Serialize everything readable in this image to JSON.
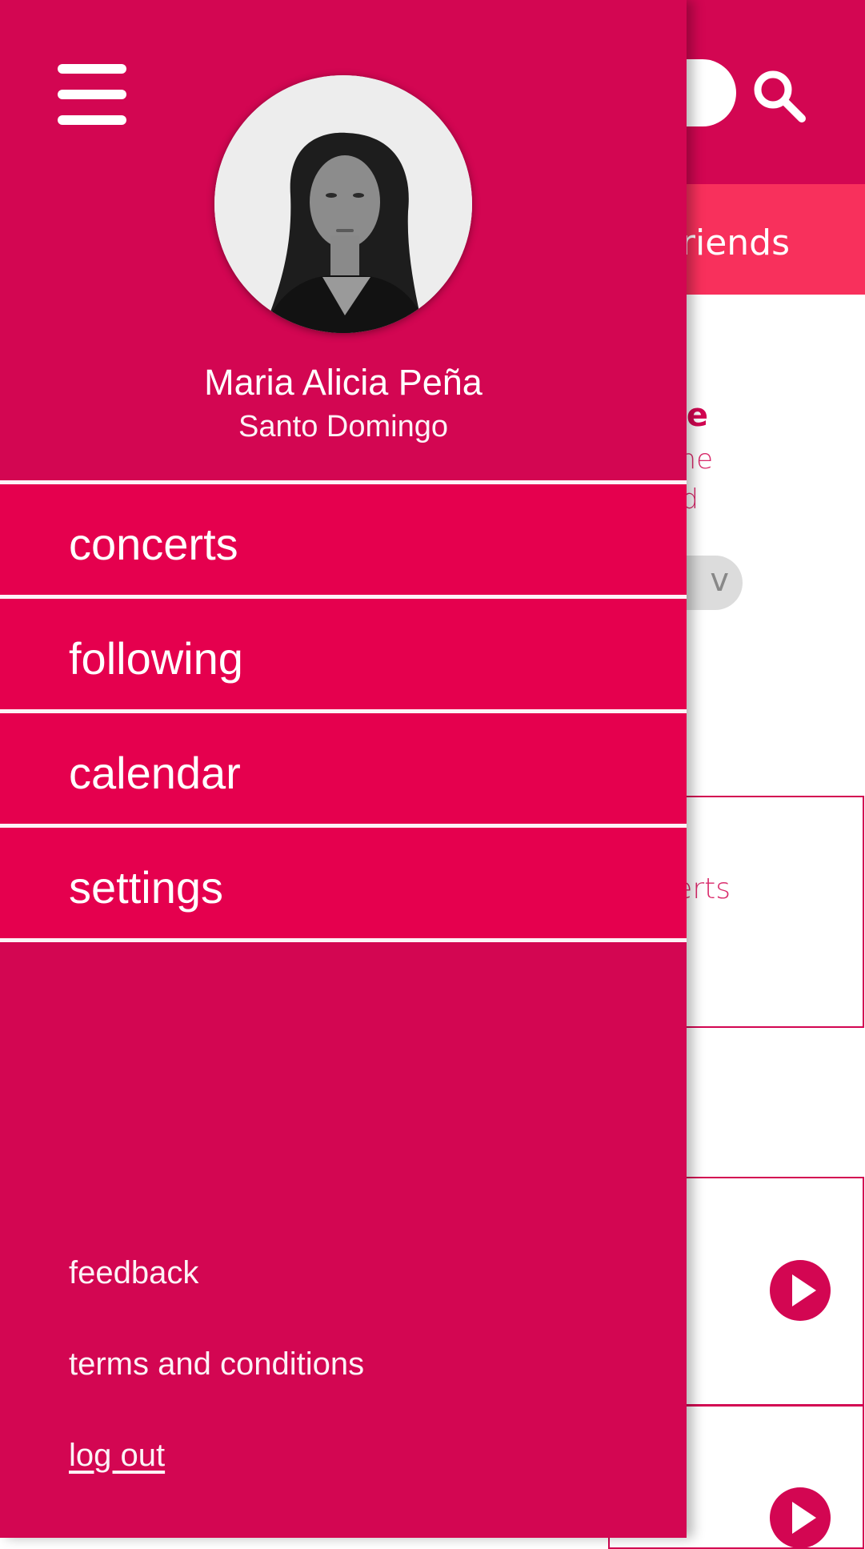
{
  "background": {
    "tab_label_fragment": "riends",
    "card_title_fragment": "e",
    "card_sub1_fragment": "ne",
    "card_sub2_fragment": "d",
    "pill_label_fragment": "v",
    "box_label_fragment": "erts"
  },
  "profile": {
    "name": "Maria Alicia Peña",
    "city": "Santo Domingo",
    "avatar_alt": "profile photo"
  },
  "menu": {
    "items": [
      {
        "label": "concerts"
      },
      {
        "label": "following"
      },
      {
        "label": "calendar"
      },
      {
        "label": "settings"
      }
    ]
  },
  "footer": {
    "feedback": "feedback",
    "terms": "terms and conditions",
    "logout": "log out"
  },
  "colors": {
    "primary": "#d30652",
    "menu_item": "#e5004e",
    "tab_bar": "#f8305c"
  }
}
